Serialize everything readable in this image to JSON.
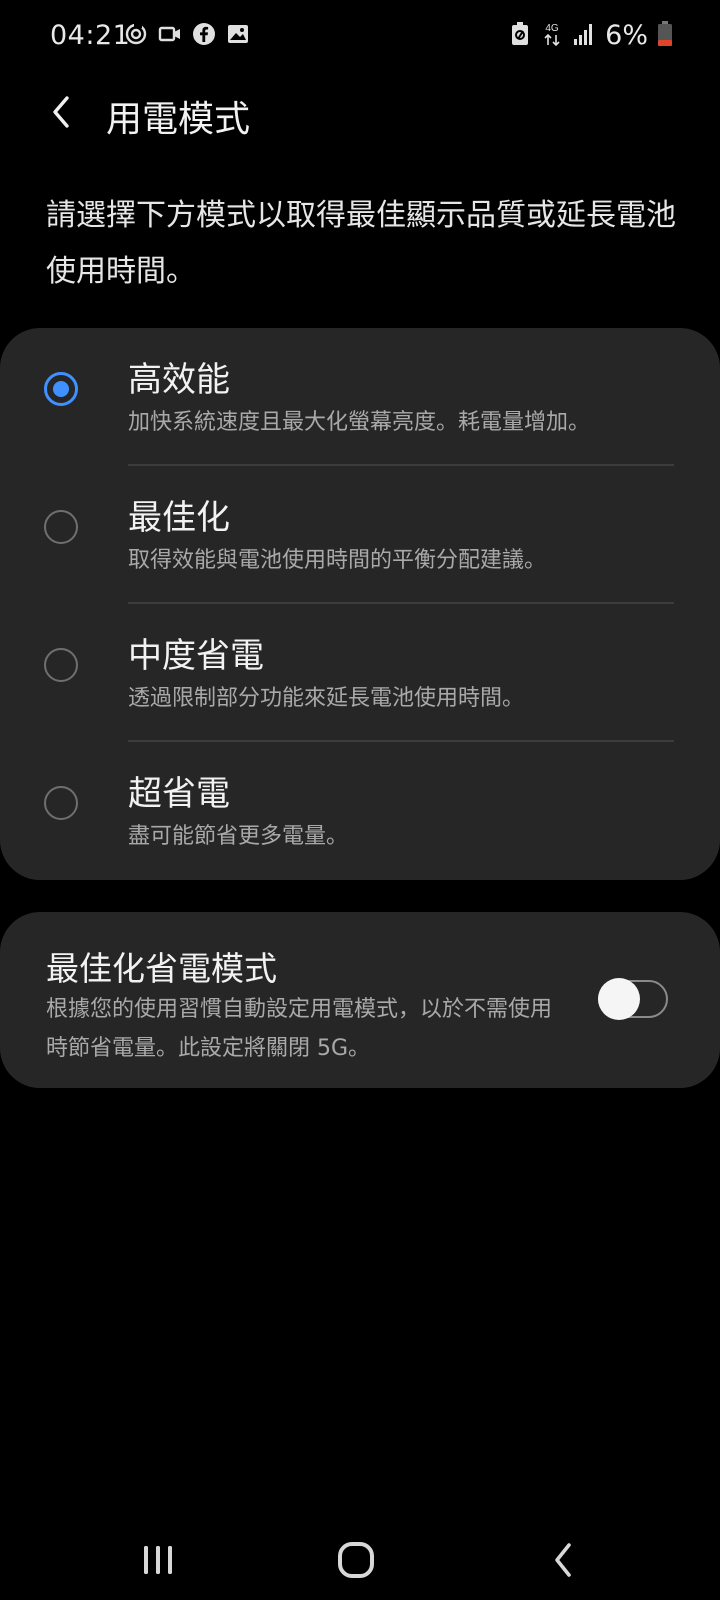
{
  "status_bar": {
    "time": "04:21",
    "network_label": "4G",
    "battery_percent": "6%",
    "left_icons": [
      "sync-icon",
      "video-icon",
      "facebook-icon",
      "gallery-icon"
    ],
    "right_icons": [
      "battery-saver-icon",
      "4g-data-icon",
      "signal-icon",
      "battery-low-icon"
    ],
    "battery_level": 0.06,
    "battery_color": "#e0452b"
  },
  "app_bar": {
    "title": "用電模式",
    "back_icon": "chevron-left-icon"
  },
  "description": "請選擇下方模式以取得最佳顯示品質或延長電池使用時間。",
  "modes": [
    {
      "title": "高效能",
      "description": "加快系統速度且最大化螢幕亮度。耗電量增加。",
      "selected": true
    },
    {
      "title": "最佳化",
      "description": "取得效能與電池使用時間的平衡分配建議。",
      "selected": false
    },
    {
      "title": "中度省電",
      "description": "透過限制部分功能來延長電池使用時間。",
      "selected": false
    },
    {
      "title": "超省電",
      "description": "盡可能節省更多電量。",
      "selected": false
    }
  ],
  "adaptive": {
    "title": "最佳化省電模式",
    "description": "根據您的使用習慣自動設定用電模式，以於不需使用時節省電量。此設定將關閉 5G。",
    "enabled": false
  },
  "nav_bar": {
    "buttons": [
      "recent-apps-icon",
      "home-icon",
      "back-icon"
    ]
  },
  "colors": {
    "accent": "#3e91ff",
    "card_background": "#262626",
    "background": "#000000"
  }
}
